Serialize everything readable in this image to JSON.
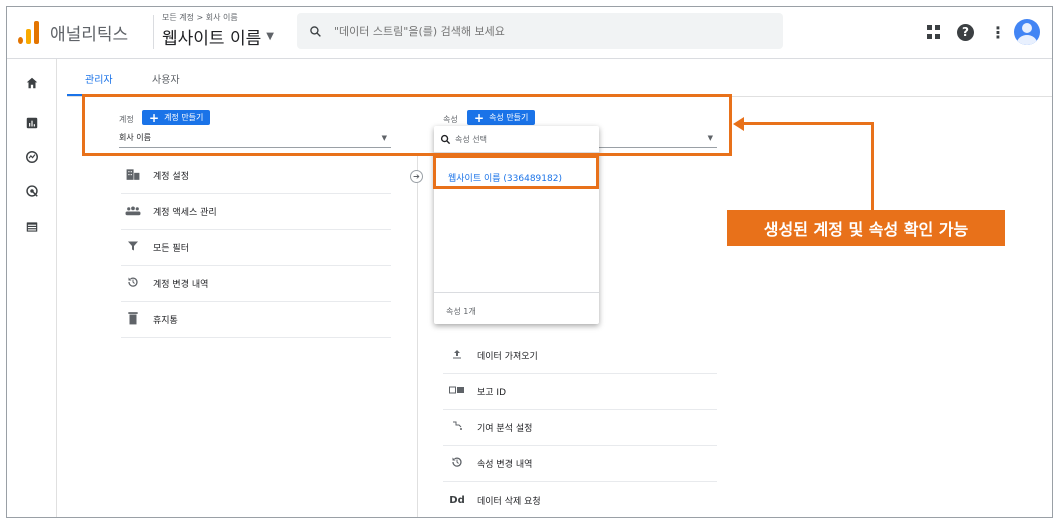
{
  "app": {
    "name": "애널리틱스",
    "breadcrumb": "모든 계정 > 회사 이름",
    "property_title": "웹사이트 이름",
    "search_placeholder": "\"데이터 스트림\"을(를) 검색해 보세요"
  },
  "tabs": [
    {
      "label": "관리자",
      "active": true
    },
    {
      "label": "사용자",
      "active": false
    }
  ],
  "account": {
    "label": "계정",
    "create_button": "계정 만들기",
    "selected": "회사 이름",
    "menu": [
      {
        "icon": "building-icon",
        "label": "계정 설정"
      },
      {
        "icon": "people-icon",
        "label": "계정 액세스 관리"
      },
      {
        "icon": "filter-icon",
        "label": "모든 필터"
      },
      {
        "icon": "history-icon",
        "label": "계정 변경 내역"
      },
      {
        "icon": "trash-icon",
        "label": "휴지통"
      }
    ]
  },
  "property": {
    "label": "속성",
    "create_button": "속성 만들기",
    "dropdown": {
      "search_placeholder": "속성 선택",
      "item": "웹사이트 이름 (336489182)",
      "footer": "속성 1개"
    },
    "menu": [
      {
        "icon": "upload-icon",
        "label": "데이터 가져오기"
      },
      {
        "icon": "report-id-icon",
        "label": "보고 ID"
      },
      {
        "icon": "attribution-icon",
        "label": "기여 분석 설정"
      },
      {
        "icon": "history-icon",
        "label": "속성 변경 내역"
      },
      {
        "icon": "dd-icon",
        "label": "데이터 삭제 요청"
      }
    ]
  },
  "callout": "생성된 계정 및 속성 확인 가능",
  "colors": {
    "accent": "#1a73e8",
    "highlight": "#e8711a",
    "logo_orange": "#f9ab00",
    "logo_dark": "#e37400"
  }
}
